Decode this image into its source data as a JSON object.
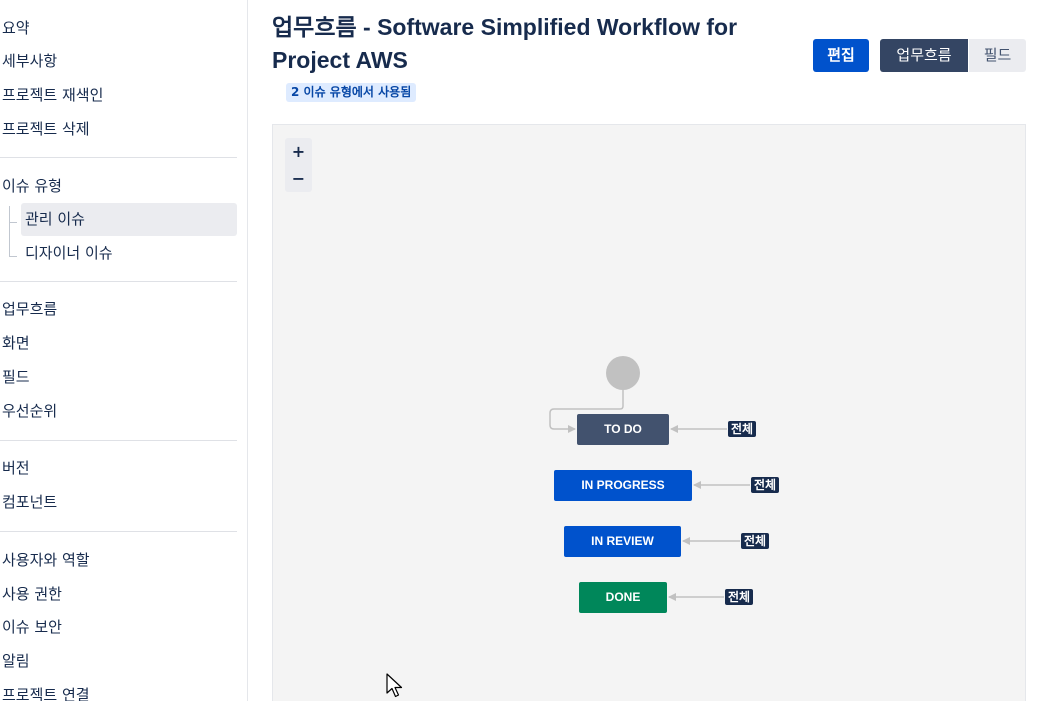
{
  "sidebar": {
    "group1": [
      "요약",
      "세부사항",
      "프로젝트 재색인",
      "프로젝트 삭제"
    ],
    "issue_types_label": "이슈 유형",
    "issue_types": [
      "관리 이슈",
      "디자이너 이슈"
    ],
    "group3": [
      "업무흐름",
      "화면",
      "필드",
      "우선순위"
    ],
    "group4": [
      "버전",
      "컴포넌트"
    ],
    "group5": [
      "사용자와 역할",
      "사용 권한",
      "이슈 보안",
      "알림",
      "프로젝트 연결"
    ]
  },
  "header": {
    "title": "업무흐름 - Software Simplified Workflow for Project AWS",
    "usage_badge": "2 이슈 유형에서 사용됨",
    "edit_label": "편집",
    "workflow_label": "업무흐름",
    "fields_label": "필드"
  },
  "diagram": {
    "zoom_in": "+",
    "zoom_out": "−",
    "statuses": [
      {
        "label": "TO DO",
        "color": "#42526e",
        "transition": "전체"
      },
      {
        "label": "IN PROGRESS",
        "color": "#0052cc",
        "transition": "전체"
      },
      {
        "label": "IN REVIEW",
        "color": "#0052cc",
        "transition": "전체"
      },
      {
        "label": "DONE",
        "color": "#00875a",
        "transition": "전체"
      }
    ]
  }
}
